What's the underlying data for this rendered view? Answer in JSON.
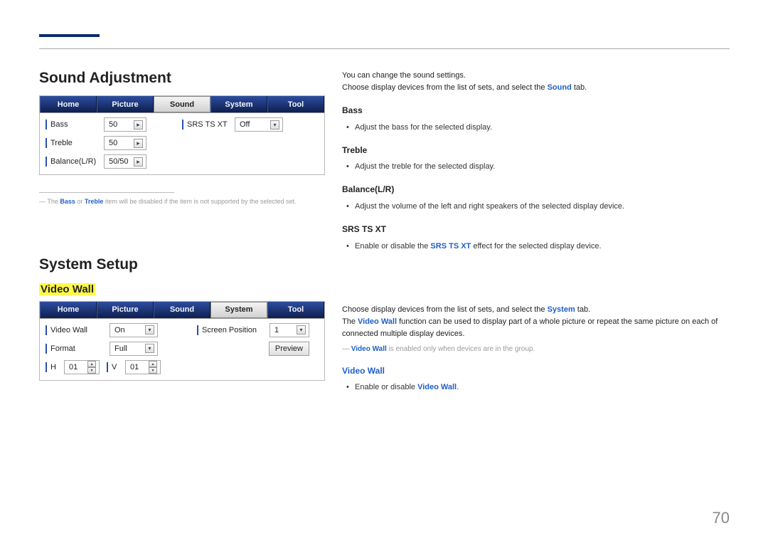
{
  "soundAdjust": {
    "title": "Sound Adjustment",
    "tabs": [
      "Home",
      "Picture",
      "Sound",
      "System",
      "Tool"
    ],
    "activeTab": 2,
    "rows": {
      "bass": {
        "label": "Bass",
        "value": "50"
      },
      "treble": {
        "label": "Treble",
        "value": "50"
      },
      "balance": {
        "label": "Balance(L/R)",
        "value": "50/50"
      },
      "srs": {
        "label": "SRS TS XT",
        "value": "Off"
      }
    },
    "footnote_prefix": "― The ",
    "footnote_b1": "Bass",
    "footnote_mid": " or ",
    "footnote_b2": "Treble",
    "footnote_suffix": " item will be disabled if the item is not supported by the selected set."
  },
  "soundRight": {
    "intro1": "You can change the sound settings.",
    "intro2a": "Choose display devices from the list of sets, and select the ",
    "intro2b": "Sound",
    "intro2c": " tab.",
    "bass": {
      "h": "Bass",
      "li": "Adjust the bass for the selected display."
    },
    "treble": {
      "h": "Treble",
      "li": "Adjust the treble for the selected display."
    },
    "balance": {
      "h": "Balance(L/R)",
      "li": "Adjust the volume of the left and right speakers of the selected display device."
    },
    "srs": {
      "h": "SRS TS XT",
      "li_a": "Enable or disable the ",
      "li_b": "SRS TS XT",
      "li_c": " effect for the selected display device."
    }
  },
  "systemSetup": {
    "title": "System Setup",
    "sub": "Video Wall",
    "tabs": [
      "Home",
      "Picture",
      "Sound",
      "System",
      "Tool"
    ],
    "activeTab": 3,
    "rows": {
      "vw": {
        "label": "Video Wall",
        "value": "On"
      },
      "sp": {
        "label": "Screen Position",
        "value": "1"
      },
      "fmt": {
        "label": "Format",
        "value": "Full"
      },
      "preview": "Preview",
      "h": {
        "label": "H",
        "value": "01"
      },
      "v": {
        "label": "V",
        "value": "01"
      }
    }
  },
  "systemRight": {
    "p1a": "Choose display devices from the list of sets, and select the ",
    "p1b": "System",
    "p1c": " tab.",
    "p2a": "The ",
    "p2b": "Video Wall",
    "p2c": " function can be used to display part of a whole picture or repeat the same picture on each of connected multiple display devices.",
    "note_a": "― ",
    "note_b": "Video Wall",
    "note_c": " is enabled only when devices are in the group.",
    "vw_h": "Video Wall",
    "vw_li_a": "Enable or disable ",
    "vw_li_b": "Video Wall",
    "vw_li_c": "."
  },
  "pageNumber": "70"
}
